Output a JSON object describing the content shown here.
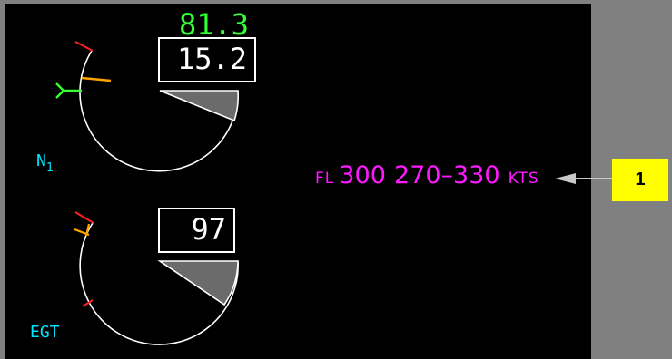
{
  "n1": {
    "target_value": "81.3",
    "current_value": "15.2",
    "label_main": "N",
    "label_sub": "1",
    "target_color": "#33ff33",
    "label_color": "#00e5ff"
  },
  "egt": {
    "current_value": "97",
    "label": "EGT"
  },
  "speed_advisory": {
    "fl_prefix": "FL",
    "flight_level": "300",
    "speed_range": "270–330",
    "unit": "KTS",
    "color": "#ff19ff"
  },
  "callout": {
    "number": "1",
    "color": "#ffff00"
  },
  "colors": {
    "dial": "#ffffff",
    "redline": "#ff2020",
    "caution": "#ffa500",
    "fill": "#6b6b6b"
  }
}
